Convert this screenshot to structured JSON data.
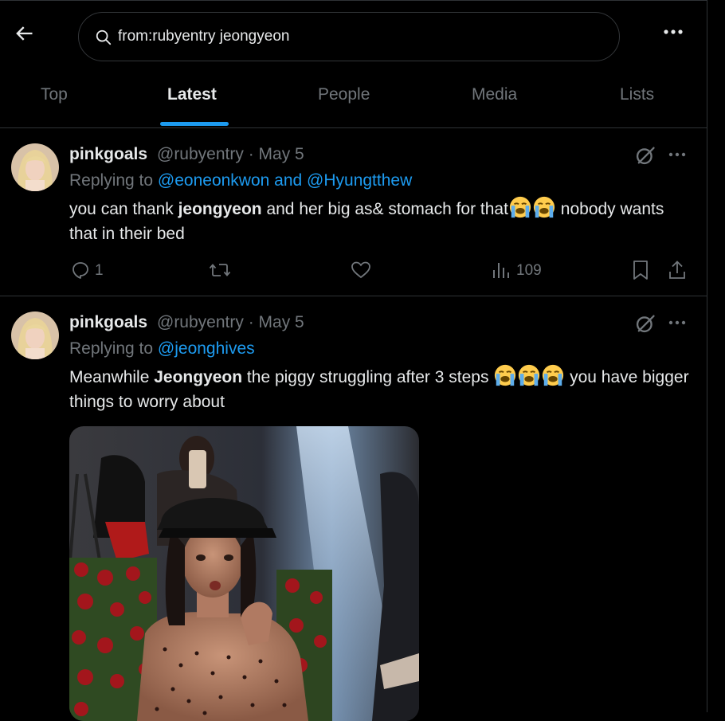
{
  "search": {
    "query": "from:rubyentry jeongyeon"
  },
  "tabs": [
    "Top",
    "Latest",
    "People",
    "Media",
    "Lists"
  ],
  "active_tab": "Latest",
  "tweets": [
    {
      "display_name": "pinkgoals",
      "handle_date": "@rubyentry · May 5",
      "replying_prefix": "Replying to ",
      "replying_mentions": "@eoneonkwon and @Hyungtthew",
      "text_1": "you can thank ",
      "text_bold": "jeongyeon",
      "text_2": " and her big as& stomach for that",
      "text_3": " nobody wants that in their bed",
      "emoji": "loudly-crying-face",
      "replies": "1",
      "views": "109"
    },
    {
      "display_name": "pinkgoals",
      "handle_date": "@rubyentry · May 5",
      "replying_prefix": "Replying to ",
      "replying_mentions": "@jeonghives",
      "text_1": "Meanwhile ",
      "text_bold": "Jeongyeon",
      "text_2": " the piggy struggling after 3 steps ",
      "text_3": " you have bigger things to worry about",
      "emoji": "loudly-crying-face"
    }
  ],
  "colors": {
    "background": "#000000",
    "accent": "#1d9bf0",
    "muted": "#71767b",
    "text": "#e7e9ea",
    "border": "#2f3336"
  }
}
